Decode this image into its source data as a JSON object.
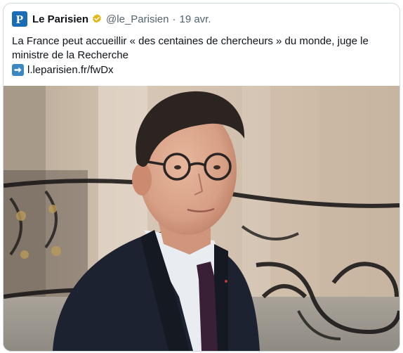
{
  "tweet": {
    "account_name": "Le Parisien",
    "handle": "@le_Parisien",
    "separator": "·",
    "date": "19 avr.",
    "avatar_letter": "P",
    "text": "La France peut accueillir « des centaines de chercheurs » du monde, juge le ministre de la Recherche",
    "link_text": "l.leparisien.fr/fwDx"
  },
  "icons": {
    "verified": "verified-badge-icon",
    "link_arrow": "right-arrow-icon"
  },
  "colors": {
    "verified_badge": "#e2b719",
    "avatar_bg": "#1a6cb5",
    "arrow_box": "#3b88c3",
    "secondary_text": "#536471"
  }
}
